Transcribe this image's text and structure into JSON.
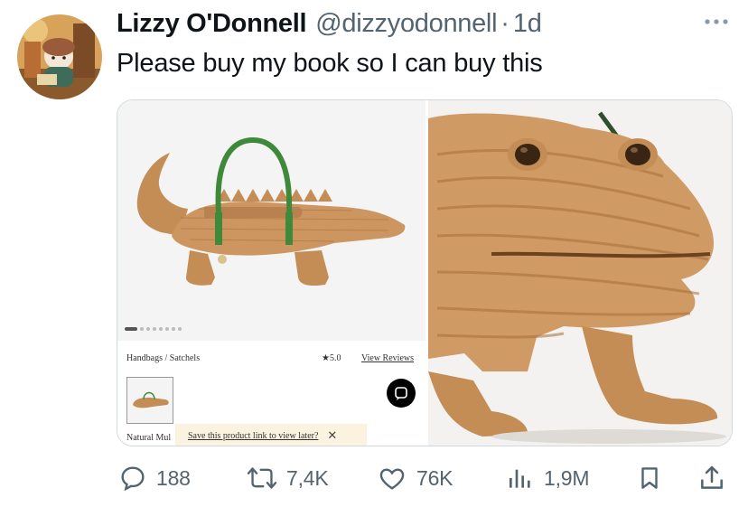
{
  "tweet": {
    "author_name": "Lizzy O'Donnell",
    "handle": "@dizzyodonnell",
    "separator": "·",
    "time": "1d",
    "text": "Please buy my book so I can buy this",
    "more_icon": "more-horizontal-icon"
  },
  "media": {
    "product_page": {
      "breadcrumb": "Handbags / Satchels",
      "rating": "★5.0",
      "reviews_link": "View Reviews",
      "variant_label": "Natural Mul",
      "save_banner": "Save this product link to view later?",
      "close_glyph": "✕",
      "chat_icon": "chat-icon",
      "carousel_dots": 8,
      "active_dot": 0
    },
    "closeup": {
      "alt_icon": "wicker-crocodile-closeup"
    }
  },
  "actions": {
    "replies": "188",
    "retweets": "7,4K",
    "likes": "76K",
    "views": "1,9M",
    "icons": [
      "reply-icon",
      "retweet-icon",
      "like-icon",
      "views-icon",
      "bookmark-icon",
      "share-icon"
    ]
  },
  "colors": {
    "text_primary": "#0f1419",
    "text_secondary": "#536471",
    "wicker": "#c9935a",
    "strap_green": "#3f8a3a"
  }
}
